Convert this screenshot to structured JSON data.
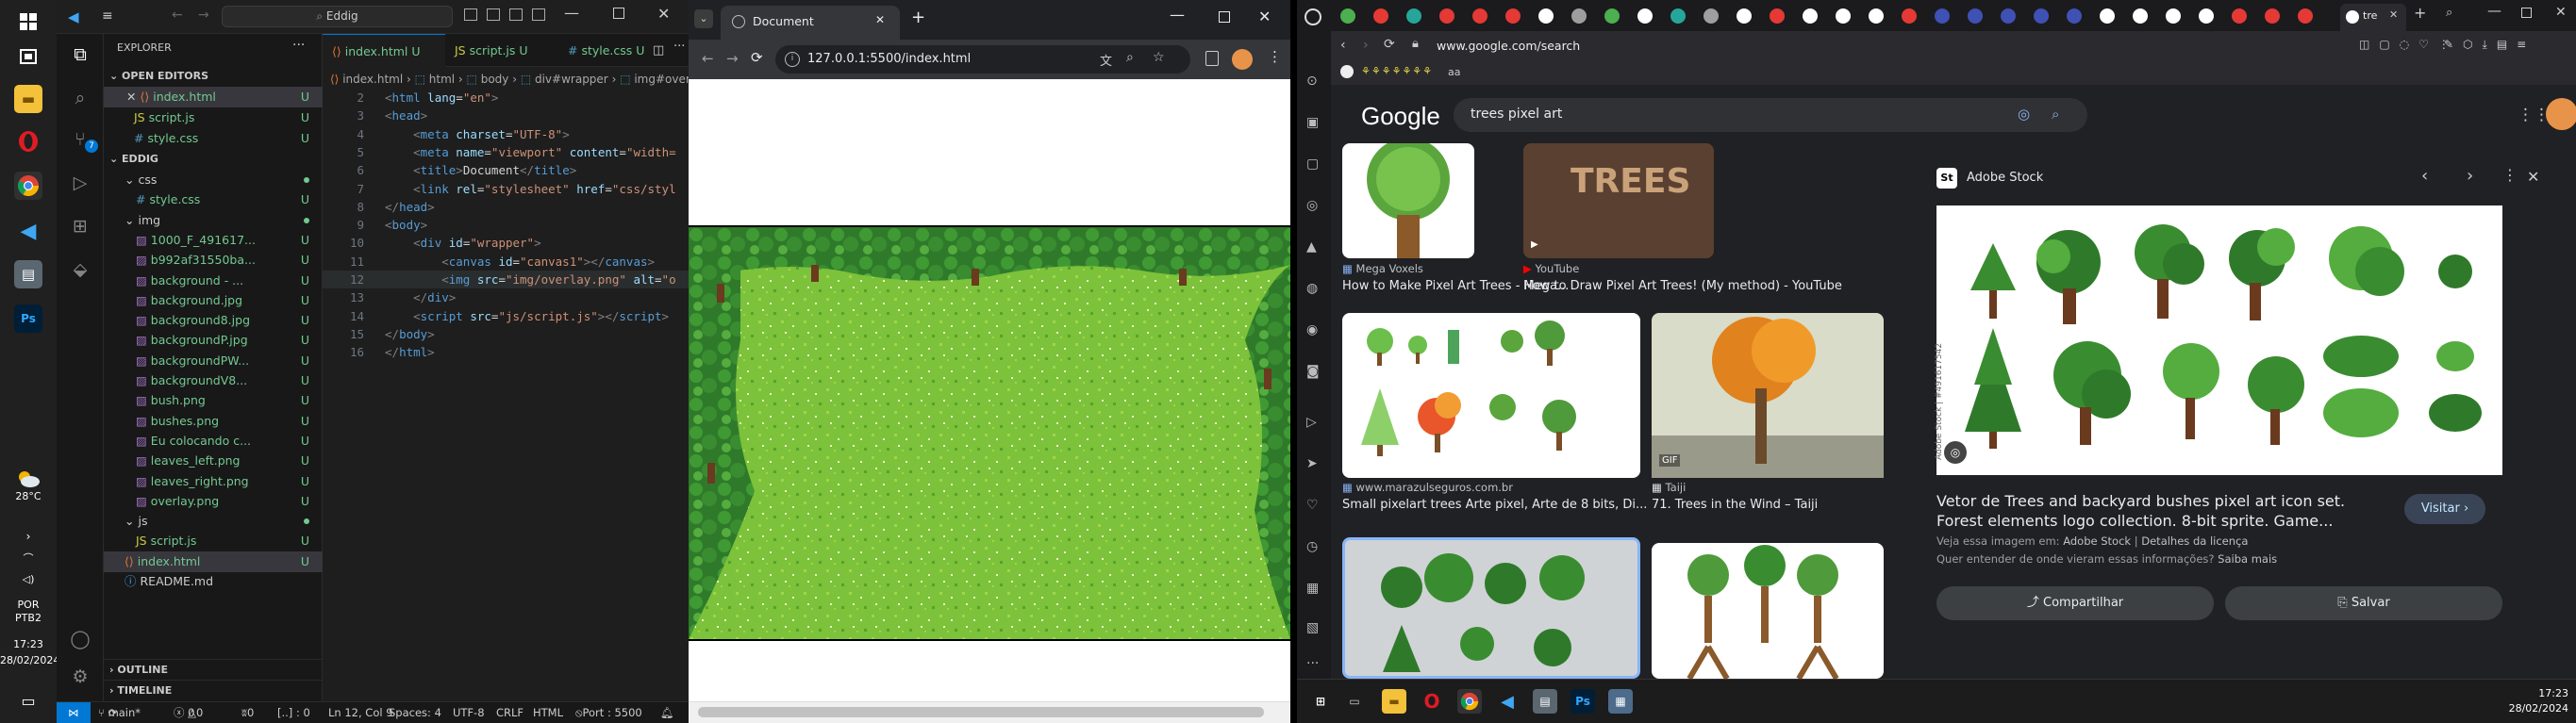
{
  "taskbar_left": {
    "weather": {
      "temp": "28°C"
    },
    "lang": {
      "line1": "POR",
      "line2": "PTB2"
    },
    "clock": {
      "time": "17:23",
      "date": "28/02/2024"
    },
    "icons": [
      "start-icon",
      "task-view-icon",
      "file-explorer-icon",
      "opera-icon",
      "chrome-icon",
      "vscode-icon",
      "files-icon",
      "photoshop-icon"
    ]
  },
  "vscode": {
    "search_placeholder": "Eddig",
    "sidebar": {
      "title": "EXPLORER",
      "open_editors_label": "OPEN EDITORS",
      "open_editors": [
        {
          "name": "index.html",
          "status": "U"
        },
        {
          "name": "script.js",
          "status": "U"
        },
        {
          "name": "style.css",
          "status": "U"
        }
      ],
      "project_label": "EDDIG",
      "tree": [
        {
          "name": "css",
          "type": "folder",
          "depth": 1,
          "status": "dot"
        },
        {
          "name": "style.css",
          "type": "css",
          "depth": 2,
          "status": "U"
        },
        {
          "name": "img",
          "type": "folder",
          "depth": 1,
          "status": "dot"
        },
        {
          "name": "1000_F_491617...",
          "type": "img",
          "depth": 2,
          "status": "U"
        },
        {
          "name": "b992af31550ba...",
          "type": "img",
          "depth": 2,
          "status": "U"
        },
        {
          "name": "background - ...",
          "type": "img",
          "depth": 2,
          "status": "U"
        },
        {
          "name": "background.jpg",
          "type": "img",
          "depth": 2,
          "status": "U"
        },
        {
          "name": "background8.jpg",
          "type": "img",
          "depth": 2,
          "status": "U"
        },
        {
          "name": "backgroundP.jpg",
          "type": "img",
          "depth": 2,
          "status": "U"
        },
        {
          "name": "backgroundPW...",
          "type": "img",
          "depth": 2,
          "status": "U"
        },
        {
          "name": "backgroundV8...",
          "type": "img",
          "depth": 2,
          "status": "U"
        },
        {
          "name": "bush.png",
          "type": "img",
          "depth": 2,
          "status": "U"
        },
        {
          "name": "bushes.png",
          "type": "img",
          "depth": 2,
          "status": "U"
        },
        {
          "name": "Eu colocando c...",
          "type": "img",
          "depth": 2,
          "status": "U"
        },
        {
          "name": "leaves_left.png",
          "type": "img",
          "depth": 2,
          "status": "U"
        },
        {
          "name": "leaves_right.png",
          "type": "img",
          "depth": 2,
          "status": "U"
        },
        {
          "name": "overlay.png",
          "type": "img",
          "depth": 2,
          "status": "U"
        },
        {
          "name": "js",
          "type": "folder",
          "depth": 1,
          "status": "dot"
        },
        {
          "name": "script.js",
          "type": "js",
          "depth": 2,
          "status": "U"
        },
        {
          "name": "index.html",
          "type": "html",
          "depth": 1,
          "status": "U"
        },
        {
          "name": "README.md",
          "type": "md",
          "depth": 1,
          "status": ""
        }
      ],
      "outline_label": "OUTLINE",
      "timeline_label": "TIMELINE"
    },
    "tabs": [
      {
        "label": "index.html",
        "status": "U"
      },
      {
        "label": "script.js",
        "status": "U"
      },
      {
        "label": "style.css",
        "status": "U"
      }
    ],
    "breadcrumb": [
      "index.html",
      "html",
      "body",
      "div#wrapper",
      "img#overlay"
    ],
    "code_lines": [
      {
        "n": "2",
        "html": "<span class='p'>&lt;</span><span class='t'>html</span> <span class='a'>lang</span><span class='x'>=</span><span class='s'>\"en\"</span><span class='p'>&gt;</span>"
      },
      {
        "n": "3",
        "html": "<span class='p'>&lt;</span><span class='t'>head</span><span class='p'>&gt;</span>"
      },
      {
        "n": "4",
        "html": "    <span class='p'>&lt;</span><span class='t'>meta</span> <span class='a'>charset</span><span class='x'>=</span><span class='s'>\"UTF-8\"</span><span class='p'>&gt;</span>"
      },
      {
        "n": "5",
        "html": "    <span class='p'>&lt;</span><span class='t'>meta</span> <span class='a'>name</span><span class='x'>=</span><span class='s'>\"viewport\"</span> <span class='a'>content</span><span class='x'>=</span><span class='s'>\"width=</span>"
      },
      {
        "n": "6",
        "html": "    <span class='p'>&lt;</span><span class='t'>title</span><span class='p'>&gt;</span><span class='x'>Document</span><span class='p'>&lt;/</span><span class='t'>title</span><span class='p'>&gt;</span>"
      },
      {
        "n": "7",
        "html": "    <span class='p'>&lt;</span><span class='t'>link</span> <span class='a'>rel</span><span class='x'>=</span><span class='s'>\"stylesheet\"</span> <span class='a'>href</span><span class='x'>=</span><span class='s'>\"css/styl</span>"
      },
      {
        "n": "8",
        "html": "<span class='p'>&lt;/</span><span class='t'>head</span><span class='p'>&gt;</span>"
      },
      {
        "n": "9",
        "html": "<span class='p'>&lt;</span><span class='t'>body</span><span class='p'>&gt;</span>"
      },
      {
        "n": "10",
        "html": "    <span class='p'>&lt;</span><span class='t'>div</span> <span class='a'>id</span><span class='x'>=</span><span class='s'>\"wrapper\"</span><span class='p'>&gt;</span>"
      },
      {
        "n": "11",
        "html": "        <span class='p'>&lt;</span><span class='t'>canvas</span> <span class='a'>id</span><span class='x'>=</span><span class='s'>\"canvas1\"</span><span class='p'>&gt;&lt;/</span><span class='t'>canvas</span><span class='p'>&gt;</span>"
      },
      {
        "n": "12",
        "html": "        <span class='p'>&lt;</span><span class='t'>img</span> <span class='a'>src</span><span class='x'>=</span><span class='s'>\"img/overlay.png\"</span> <span class='a'>alt</span><span class='x'>=</span><span class='s'>\"o</span>"
      },
      {
        "n": "13",
        "html": "    <span class='p'>&lt;/</span><span class='t'>div</span><span class='p'>&gt;</span>"
      },
      {
        "n": "14",
        "html": "    <span class='p'>&lt;</span><span class='t'>script</span> <span class='a'>src</span><span class='x'>=</span><span class='s'>\"js/script.js\"</span><span class='p'>&gt;&lt;/</span><span class='t'>script</span><span class='p'>&gt;</span>"
      },
      {
        "n": "15",
        "html": "<span class='p'>&lt;/</span><span class='t'>body</span><span class='p'>&gt;</span>"
      },
      {
        "n": "16",
        "html": "<span class='p'>&lt;/</span><span class='t'>html</span><span class='p'>&gt;</span>"
      }
    ],
    "status": {
      "branch": "main*",
      "errors": "0",
      "warnings": "0",
      "ports": "0",
      "selection": "[..] : 0",
      "position": "Ln 12, Col 9",
      "spaces": "Spaces: 4",
      "encoding": "UTF-8",
      "eol": "CRLF",
      "language": "HTML",
      "port": "Port : 5500"
    }
  },
  "browser1": {
    "tab_title": "Document",
    "url": "127.0.0.1:5500/index.html"
  },
  "browser2": {
    "url": "www.google.com/search",
    "bookmark_label": "aa",
    "google_logo": "Google",
    "search_query": "trees pixel art",
    "results": [
      {
        "source": "Mega Voxels",
        "title": "How to Make Pixel Art Trees - Mega..."
      },
      {
        "source": "YouTube",
        "title": "How to Draw Pixel Art Trees! (My method) - YouTube"
      },
      {
        "source": "www.marazulseguros.com.br",
        "title": "Small pixelart trees Arte pixel, Arte de 8 bits, Di..."
      },
      {
        "source": "Taiji",
        "title": "71. Trees in the Wind – Taiji"
      }
    ],
    "gif_badge": "GIF",
    "panel": {
      "source": "Adobe Stock",
      "title_line1": "Vetor de Trees and backyard bushes pixel art icon set.",
      "title_line2": "Forest elements logo collection. 8-bit sprite. Game...",
      "visit_label": "Visitar",
      "subtitle_prefix": "Veja essa imagem em:",
      "subtitle_source": "Adobe Stock",
      "subtitle_sep": " | ",
      "subtitle_license": "Detalhes da licença",
      "question": "Quer entender de onde vieram essas informações?",
      "question_link": "Saiba mais",
      "share_label": "Compartilhar",
      "save_label": "Salvar",
      "watermark": "Adobe Stock | #491617542"
    },
    "taskbar": {
      "time": "17:23",
      "date": "28/02/2024"
    }
  }
}
